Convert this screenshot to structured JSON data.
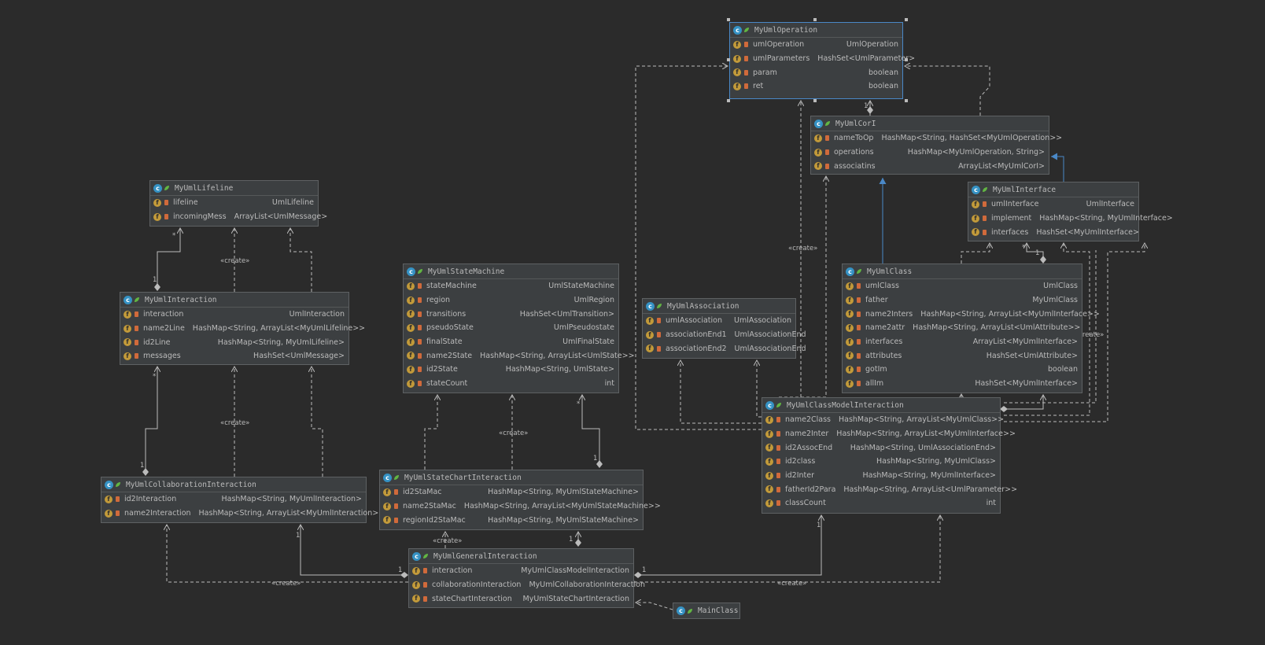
{
  "classes": [
    {
      "name": "MyUmlOperation",
      "fields": [
        [
          "umlOperation",
          "UmlOperation"
        ],
        [
          "umlParameters",
          "HashSet<UmlParameter>"
        ],
        [
          "param",
          "boolean"
        ],
        [
          "ret",
          "boolean"
        ]
      ]
    },
    {
      "name": "MyUmlCorI",
      "fields": [
        [
          "nameToOp",
          "HashMap<String, HashSet<MyUmlOperation>>"
        ],
        [
          "operations",
          "HashMap<MyUmlOperation, String>"
        ],
        [
          "associatins",
          "ArrayList<MyUmlCorI>"
        ]
      ]
    },
    {
      "name": "MyUmlInterface",
      "fields": [
        [
          "umlInterface",
          "UmlInterface"
        ],
        [
          "implement",
          "HashMap<String, MyUmlInterface>"
        ],
        [
          "interfaces",
          "HashSet<MyUmlInterface>"
        ]
      ]
    },
    {
      "name": "MyUmlLifeline",
      "fields": [
        [
          "lifeline",
          "UmlLifeline"
        ],
        [
          "incomingMess",
          "ArrayList<UmlMessage>"
        ]
      ]
    },
    {
      "name": "MyUmlInteraction",
      "fields": [
        [
          "interaction",
          "UmlInteraction"
        ],
        [
          "name2Line",
          "HashMap<String, ArrayList<MyUmlLifeline>>"
        ],
        [
          "id2Line",
          "HashMap<String, MyUmlLifeline>"
        ],
        [
          "messages",
          "HashSet<UmlMessage>"
        ]
      ]
    },
    {
      "name": "MyUmlStateMachine",
      "fields": [
        [
          "stateMachine",
          "UmlStateMachine"
        ],
        [
          "region",
          "UmlRegion"
        ],
        [
          "transitions",
          "HashSet<UmlTransition>"
        ],
        [
          "pseudoState",
          "UmlPseudostate"
        ],
        [
          "finalState",
          "UmlFinalState"
        ],
        [
          "name2State",
          "HashMap<String, ArrayList<UmlState>>"
        ],
        [
          "id2State",
          "HashMap<String, UmlState>"
        ],
        [
          "stateCount",
          "int"
        ]
      ]
    },
    {
      "name": "MyUmlAssociation",
      "fields": [
        [
          "umlAssociation",
          "UmlAssociation"
        ],
        [
          "associationEnd1",
          "UmlAssociationEnd"
        ],
        [
          "associationEnd2",
          "UmlAssociationEnd"
        ]
      ]
    },
    {
      "name": "MyUmlClass",
      "fields": [
        [
          "umlClass",
          "UmlClass"
        ],
        [
          "father",
          "MyUmlClass"
        ],
        [
          "name2Inters",
          "HashMap<String, ArrayList<MyUmlInterface>>"
        ],
        [
          "name2attr",
          "HashMap<String, ArrayList<UmlAttribute>>"
        ],
        [
          "interfaces",
          "ArrayList<MyUmlInterface>"
        ],
        [
          "attributes",
          "HashSet<UmlAttribute>"
        ],
        [
          "gotIm",
          "boolean"
        ],
        [
          "allIm",
          "HashSet<MyUmlInterface>"
        ]
      ]
    },
    {
      "name": "MyUmlClassModelInteraction",
      "fields": [
        [
          "name2Class",
          "HashMap<String, ArrayList<MyUmlClass>>"
        ],
        [
          "name2Inter",
          "HashMap<String, ArrayList<MyUmlInterface>>"
        ],
        [
          "id2AssocEnd",
          "HashMap<String, UmlAssociationEnd>"
        ],
        [
          "id2class",
          "HashMap<String, MyUmlClass>"
        ],
        [
          "id2Inter",
          "HashMap<String, MyUmlInterface>"
        ],
        [
          "fatherId2Para",
          "HashMap<String, ArrayList<UmlParameter>>"
        ],
        [
          "classCount",
          "int"
        ]
      ]
    },
    {
      "name": "MyUmlCollaborationInteraction",
      "fields": [
        [
          "id2Interaction",
          "HashMap<String, MyUmlInteraction>"
        ],
        [
          "name2Interaction",
          "HashMap<String, ArrayList<MyUmlInteraction>>"
        ]
      ]
    },
    {
      "name": "MyUmlStateChartInteraction",
      "fields": [
        [
          "id2StaMac",
          "HashMap<String, MyUmlStateMachine>"
        ],
        [
          "name2StaMac",
          "HashMap<String, ArrayList<MyUmlStateMachine>>"
        ],
        [
          "regionId2StaMac",
          "HashMap<String, MyUmlStateMachine>"
        ]
      ]
    },
    {
      "name": "MyUmlGeneralInteraction",
      "fields": [
        [
          "interaction",
          "MyUmlClassModelInteraction"
        ],
        [
          "collaborationInteraction",
          "MyUmlCollaborationInteraction"
        ],
        [
          "stateChartInteraction",
          "MyUmlStateChartInteraction"
        ]
      ]
    },
    {
      "name": "MainClass",
      "fields": []
    }
  ],
  "edge_labels": {
    "create": "«create»",
    "create_overlap": "«create»",
    "one": "1",
    "many": "*"
  },
  "icons": {
    "class": "c",
    "field": "f"
  },
  "colors": {
    "background": "#2b2b2b",
    "node": "#3c3f41",
    "edge": "#bbbbbb",
    "inheritance": "#4a88c7",
    "class_icon": "#3592c4",
    "field_icon": "#c29a3a",
    "selected_border": "#4a88c7"
  }
}
